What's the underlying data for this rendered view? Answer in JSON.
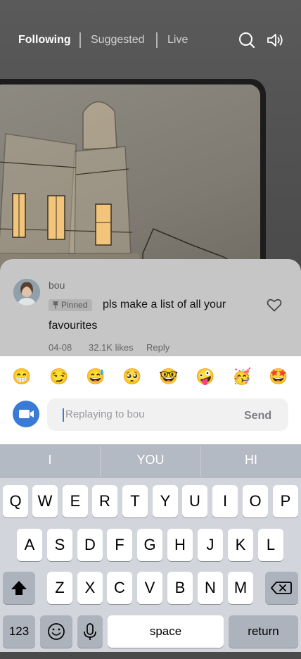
{
  "nav": {
    "tabs": [
      "Following",
      "Suggested",
      "Live"
    ],
    "active_tab": "Following",
    "icons": [
      "search-icon",
      "speaker-icon"
    ]
  },
  "comment": {
    "username": "bou",
    "pinned_label": "Pinned",
    "text_line1": "pls make a list of all your",
    "text_line2": "favourites",
    "date": "04-08",
    "likes": "32.1K likes",
    "reply_label": "Reply"
  },
  "emojis": [
    "😁",
    "😏",
    "😅",
    "🥺",
    "🤓",
    "🤪",
    "🥳",
    "🤩"
  ],
  "composer": {
    "placeholder": "Replaying to bou",
    "send_label": "Send"
  },
  "keyboard": {
    "suggestions": [
      "I",
      "YOU",
      "HI"
    ],
    "row1": [
      "Q",
      "W",
      "E",
      "R",
      "T",
      "Y",
      "U",
      "I",
      "O",
      "P"
    ],
    "row2": [
      "A",
      "S",
      "D",
      "F",
      "G",
      "H",
      "J",
      "K",
      "L"
    ],
    "row3": [
      "Z",
      "X",
      "C",
      "V",
      "B",
      "N",
      "M"
    ],
    "numbers_label": "123",
    "space_label": "space",
    "return_label": "return"
  },
  "colors": {
    "accent": "#3a7bd5",
    "sheet": "#c6c6c6",
    "keyboard": "#d2d5db"
  }
}
